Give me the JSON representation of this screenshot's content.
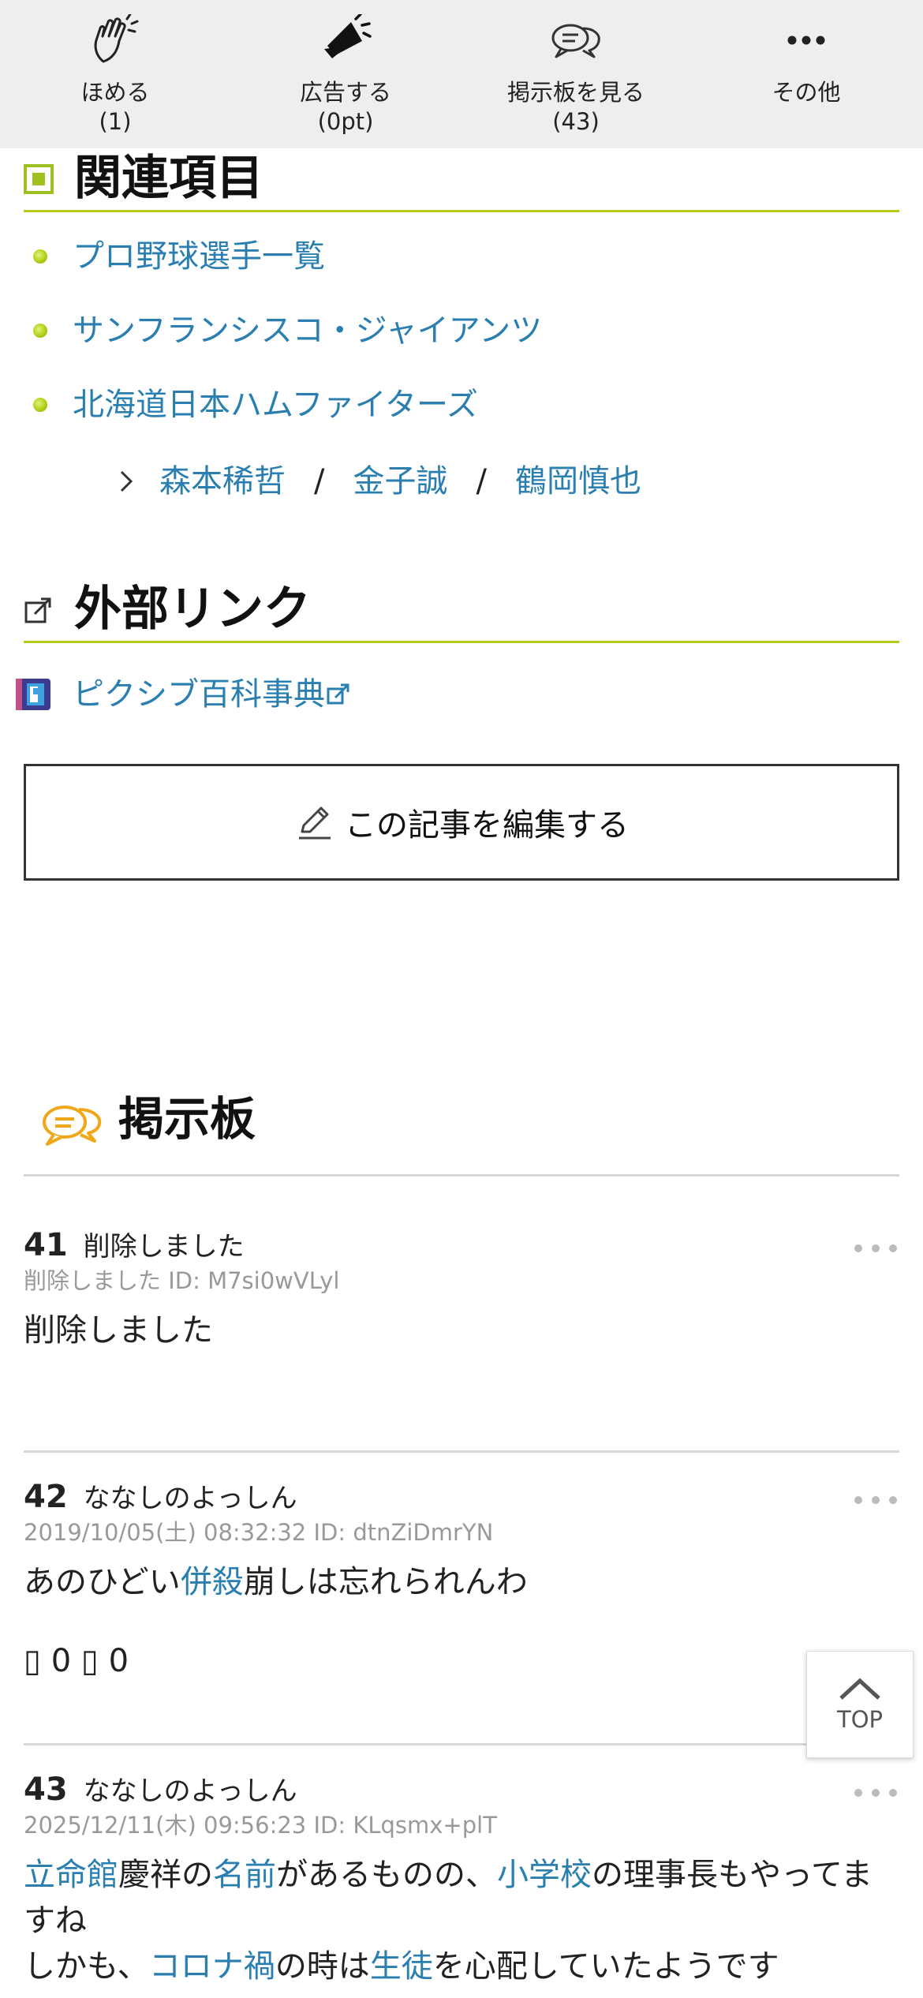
{
  "actions": [
    {
      "label": "ほめる",
      "count": "(1)",
      "icon": "clapping-hands-icon"
    },
    {
      "label": "広告する",
      "count": "(0pt)",
      "icon": "megaphone-icon"
    },
    {
      "label": "掲示板を見る",
      "count": "(43)",
      "icon": "speech-bubbles-icon"
    },
    {
      "label": "その他",
      "count": "",
      "icon": "more-dots-icon"
    }
  ],
  "related": {
    "heading": "関連項目",
    "items": [
      "プロ野球選手一覧",
      "サンフランシスコ・ジャイアンツ",
      "北海道日本ハムファイターズ"
    ],
    "sub_links": [
      "森本稀哲",
      "金子誠",
      "鶴岡慎也"
    ],
    "separator": "/"
  },
  "external": {
    "heading": "外部リンク",
    "link": "ピクシブ百科事典"
  },
  "edit_button": "この記事を編集する",
  "board": {
    "heading": "掲示板",
    "posts": [
      {
        "num": "41",
        "name": "削除しました",
        "meta": "削除しました ID: M7si0wVLyl",
        "body": "削除しました"
      },
      {
        "num": "42",
        "name": "ななしのよっしん",
        "meta": "2019/10/05(土) 08:32:32 ID: dtnZiDmrYN",
        "body_pre": "あのひどい",
        "body_link": "併殺",
        "body_post": "崩しは忘れられんわ",
        "votes": "▯ 0 ▯ 0"
      },
      {
        "num": "43",
        "name": "ななしのよっしん",
        "meta": "2025/12/11(木) 09:56:23 ID: KLqsmx+plT",
        "l1_link1": "立命館",
        "l1_t1": "慶祥の",
        "l1_link2": "名前",
        "l1_t2": "があるものの、",
        "l1_link3": "小学校",
        "l1_t3": "の理事長もやってますね",
        "l2_t1": "しかも、",
        "l2_link1": "コロナ禍",
        "l2_t2": "の時は",
        "l2_link2": "生徒",
        "l2_t3": "を心配していたようです"
      }
    ]
  },
  "top_button": "TOP",
  "colors": {
    "link": "#2a7fb0",
    "accent_line": "#b5c918",
    "topbar_bg": "#eeeeee"
  }
}
